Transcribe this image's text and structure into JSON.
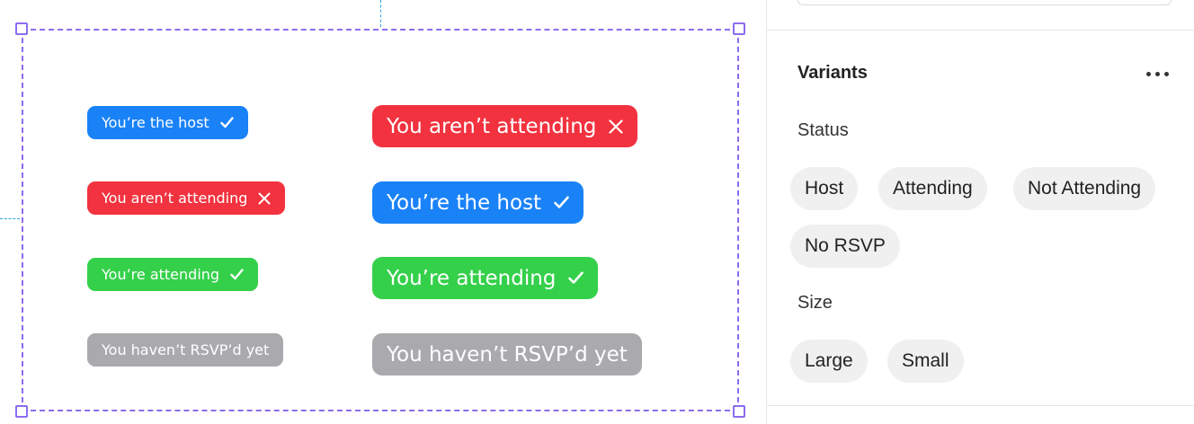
{
  "canvas": {
    "small_badges": [
      {
        "label": "You’re the host",
        "status": "host",
        "icon": "check-icon",
        "color": "#1a82f7"
      },
      {
        "label": "You aren’t attending",
        "status": "not-attending",
        "icon": "x-icon",
        "color": "#f2323f"
      },
      {
        "label": "You’re attending",
        "status": "attending",
        "icon": "check-icon",
        "color": "#34d04a"
      },
      {
        "label": "You haven’t RSVP’d yet",
        "status": "no-rsvp",
        "icon": "",
        "color": "#aaaaae"
      }
    ],
    "large_badges": [
      {
        "label": "You aren’t attending",
        "status": "not-attending",
        "icon": "x-icon",
        "color": "#f2323f"
      },
      {
        "label": "You’re the host",
        "status": "host",
        "icon": "check-icon",
        "color": "#1a82f7"
      },
      {
        "label": "You’re attending",
        "status": "attending",
        "icon": "check-icon",
        "color": "#34d04a"
      },
      {
        "label": "You haven’t RSVP’d yet",
        "status": "no-rsvp",
        "icon": "",
        "color": "#aaaaae"
      }
    ],
    "selection_color": "#8c6cf0",
    "guide_color": "#29a3e6"
  },
  "panel": {
    "title": "Variants",
    "more_icon": "more-horizontal-icon",
    "status": {
      "label": "Status",
      "options": [
        "Host",
        "Attending",
        "Not Attending",
        "No RSVP"
      ]
    },
    "size": {
      "label": "Size",
      "options": [
        "Large",
        "Small"
      ]
    }
  }
}
